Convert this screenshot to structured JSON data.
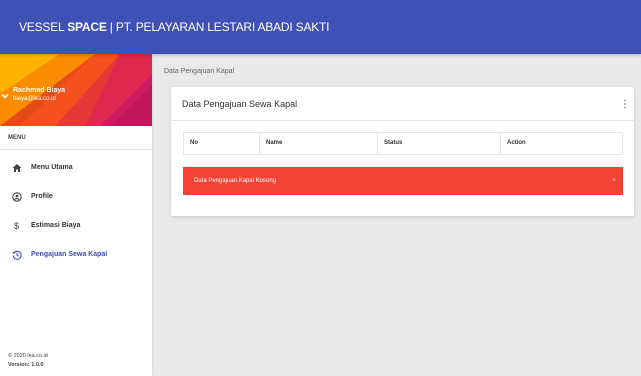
{
  "topbar": {
    "brand_prefix": "VESSEL ",
    "brand_bold": "SPACE",
    "brand_suffix": " | PT. PELAYARAN LESTARI ABADI SAKTI"
  },
  "user": {
    "name": "Rachmad Biaya",
    "email": "biaya@lea.co.id"
  },
  "sidebar": {
    "menu_label": "MENU",
    "items": [
      {
        "label": "Menu Utama",
        "icon": "home-icon",
        "active": false
      },
      {
        "label": "Profile",
        "icon": "user-icon",
        "active": false
      },
      {
        "label": "Estimasi Biaya",
        "icon": "dollar-icon",
        "active": false
      },
      {
        "label": "Pengajuan Sewa Kapal",
        "icon": "history-icon",
        "active": true
      }
    ],
    "footer": {
      "copyright": "© 2020 lea.co.id",
      "version": "Version: 1.0.0"
    }
  },
  "main": {
    "breadcrumb": "Data Pengajuan Kapal",
    "card": {
      "title": "Data Pengajuan Sewa Kapal",
      "columns": [
        "No",
        "Name",
        "Status",
        "Action"
      ],
      "alert": "Data Pengajuan Kapal Kosong",
      "alert_close": "×"
    }
  },
  "colors": {
    "primary": "#3f51b5",
    "alert": "#f44336",
    "background": "#e9e9e9"
  }
}
